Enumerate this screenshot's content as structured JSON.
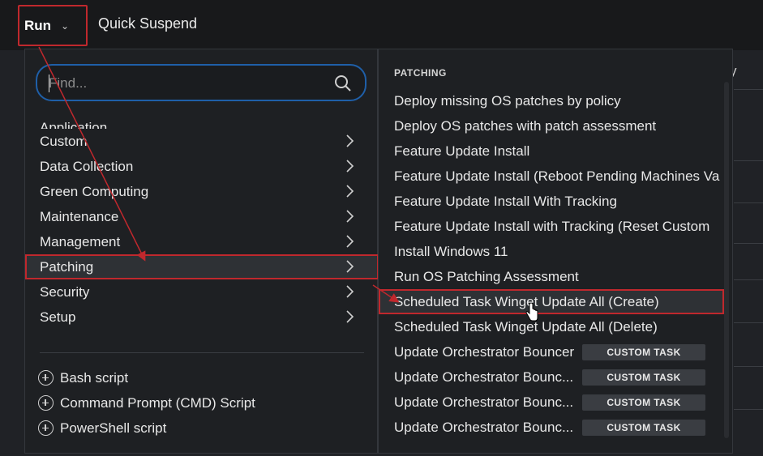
{
  "topbar": {
    "run_label": "Run",
    "quick_label": "Quick Suspend"
  },
  "background": {
    "right_text": "y"
  },
  "search": {
    "placeholder": "Find..."
  },
  "categories": [
    {
      "label": "Application"
    },
    {
      "label": "Custom"
    },
    {
      "label": "Data Collection"
    },
    {
      "label": "Green Computing"
    },
    {
      "label": "Maintenance"
    },
    {
      "label": "Management"
    },
    {
      "label": "Patching"
    },
    {
      "label": "Security"
    },
    {
      "label": "Setup"
    }
  ],
  "scripts": [
    {
      "label": "Bash script"
    },
    {
      "label": "Command Prompt (CMD) Script"
    },
    {
      "label": "PowerShell script"
    }
  ],
  "patching": {
    "title": "PATCHING",
    "tasks": [
      {
        "label": "Deploy missing OS patches by policy"
      },
      {
        "label": "Deploy OS patches with patch assessment"
      },
      {
        "label": "Feature Update Install"
      },
      {
        "label": "Feature Update Install (Reboot Pending Machines Va"
      },
      {
        "label": "Feature Update Install With Tracking"
      },
      {
        "label": "Feature Update Install with Tracking (Reset Custom"
      },
      {
        "label": "Install Windows 11"
      },
      {
        "label": "Run OS Patching Assessment"
      },
      {
        "label": "Scheduled Task Winget Update All (Create)"
      },
      {
        "label": "Scheduled Task Winget Update All (Delete)"
      },
      {
        "label": "Update Orchestrator Bouncer",
        "badge": "CUSTOM TASK"
      },
      {
        "label": "Update Orchestrator Bounc...",
        "badge": "CUSTOM TASK"
      },
      {
        "label": "Update Orchestrator Bounc...",
        "badge": "CUSTOM TASK"
      },
      {
        "label": "Update Orchestrator Bounc...",
        "badge": "CUSTOM TASK"
      }
    ]
  },
  "colors": {
    "highlight": "#c0282d",
    "search_border": "#1f5fa8",
    "panel_bg": "#1e2023"
  }
}
